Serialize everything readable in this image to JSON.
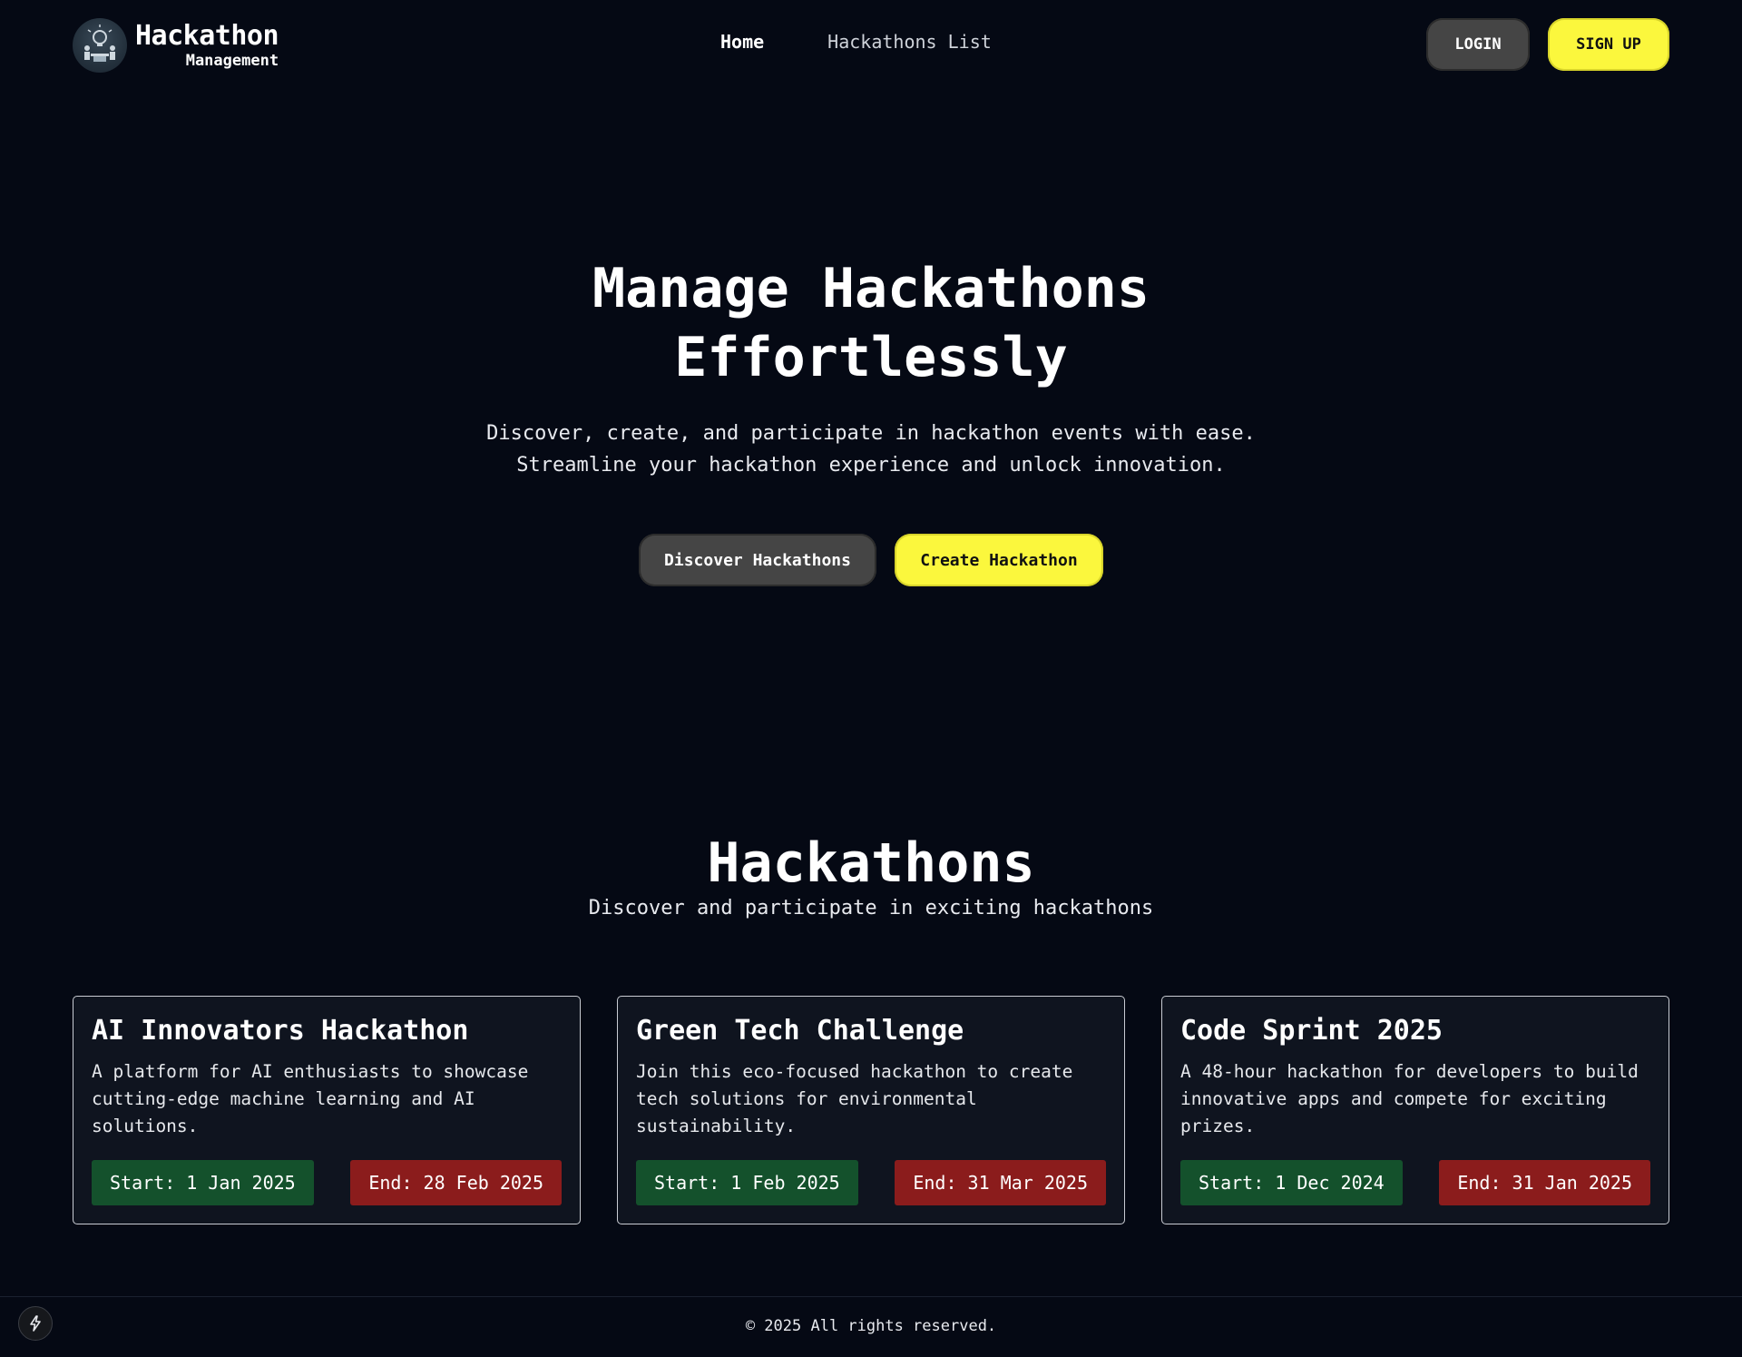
{
  "brand": {
    "title": "Hackathon",
    "subtitle": "Management",
    "logo_icon": "lightbulb-team-icon"
  },
  "nav": {
    "links": [
      {
        "label": "Home",
        "active": true
      },
      {
        "label": "Hackathons List",
        "active": false
      }
    ],
    "login_label": "LOGIN",
    "signup_label": "SIGN UP"
  },
  "hero": {
    "title_line1": "Manage Hackathons",
    "title_line2": "Effortlessly",
    "subtitle_line1": "Discover, create, and participate in hackathon events with ease.",
    "subtitle_line2": "Streamline your hackathon experience and unlock innovation.",
    "discover_label": "Discover Hackathons",
    "create_label": "Create Hackathon"
  },
  "section": {
    "title": "Hackathons",
    "subtitle": "Discover and participate in exciting hackathons"
  },
  "cards": [
    {
      "title": "AI Innovators Hackathon",
      "description": "A platform for AI enthusiasts to showcase cutting-edge machine learning and AI solutions.",
      "start": "Start: 1 Jan 2025",
      "end": "End: 28 Feb 2025"
    },
    {
      "title": "Green Tech Challenge",
      "description": "Join this eco-focused hackathon to create tech solutions for environmental sustainability.",
      "start": "Start: 1 Feb 2025",
      "end": "End: 31 Mar 2025"
    },
    {
      "title": "Code Sprint 2025",
      "description": "A 48-hour hackathon for developers to build innovative apps and compete for exciting prizes.",
      "start": "Start: 1 Dec 2024",
      "end": "End: 31 Jan 2025"
    }
  ],
  "footer": {
    "text": "© 2025 All rights reserved.",
    "bolt_icon": "lightning-bolt-icon"
  },
  "colors": {
    "background": "#050914",
    "accent_yellow": "#fbf73d",
    "button_dark": "#454545",
    "card_bg": "#0f141f",
    "start_green": "#14512c",
    "end_red": "#8b1c1c"
  }
}
